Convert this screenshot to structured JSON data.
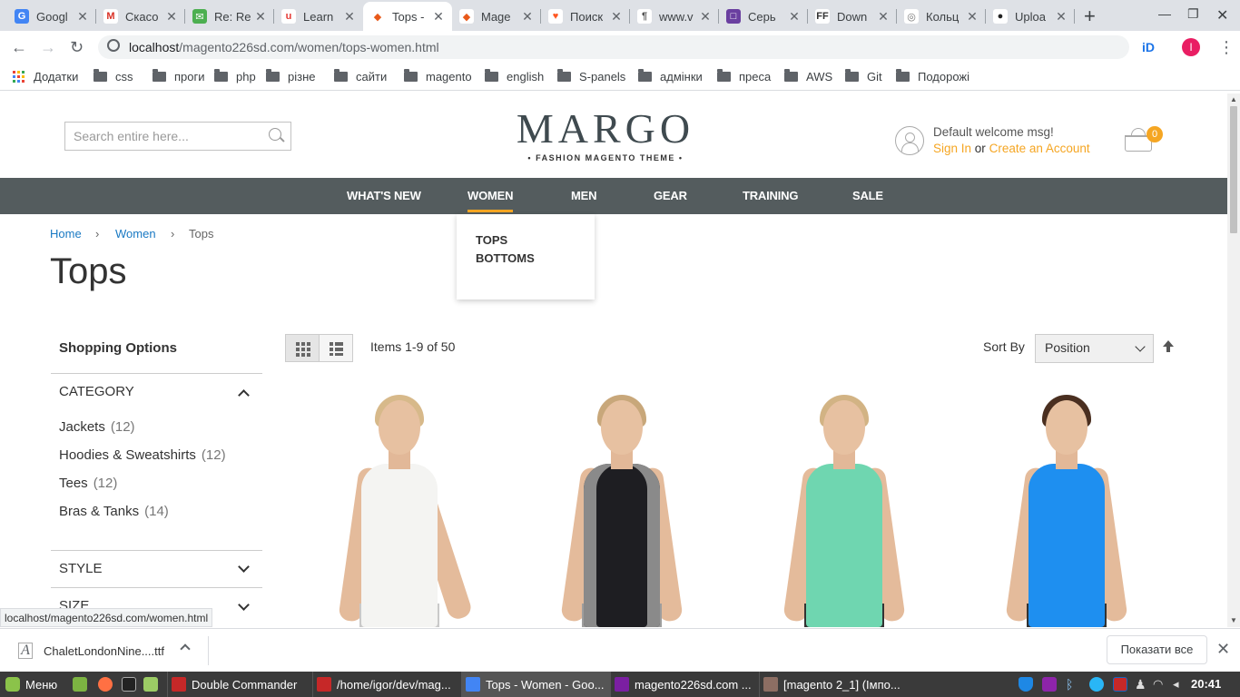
{
  "browser": {
    "tabs": [
      {
        "title": "Googl",
        "fav_bg": "#4285f4",
        "fav_txt": "G"
      },
      {
        "title": "Скасо",
        "fav_bg": "#ffffff",
        "fav_txt": "M",
        "fav_color": "#d93025"
      },
      {
        "title": "Re: Re",
        "fav_bg": "#4caf50",
        "fav_txt": "✉"
      },
      {
        "title": "Learn",
        "fav_bg": "#ffffff",
        "fav_txt": "u",
        "fav_color": "#e53935"
      },
      {
        "title": "Tops -",
        "fav_bg": "#ffffff",
        "fav_txt": "◆",
        "fav_color": "#e8591a",
        "active": true
      },
      {
        "title": "Mage",
        "fav_bg": "#ffffff",
        "fav_txt": "◆",
        "fav_color": "#e8591a"
      },
      {
        "title": "Поиск",
        "fav_bg": "#ffffff",
        "fav_txt": "♥",
        "fav_color": "#ff5722"
      },
      {
        "title": "www.v",
        "fav_bg": "#ffffff",
        "fav_txt": "¶",
        "fav_color": "#555555"
      },
      {
        "title": "Серь",
        "fav_bg": "#6a3fa0",
        "fav_txt": "□"
      },
      {
        "title": "Down",
        "fav_bg": "#ffffff",
        "fav_txt": "FF",
        "fav_color": "#333333"
      },
      {
        "title": "Кольц",
        "fav_bg": "#ffffff",
        "fav_txt": "◎",
        "fav_color": "#777777"
      },
      {
        "title": "Uploa",
        "fav_bg": "#ffffff",
        "fav_txt": "●",
        "fav_color": "#222222"
      }
    ],
    "url_host": "localhost",
    "url_path": "/magento226sd.com/women/tops-women.html",
    "profile_initial": "I",
    "bookmarks": [
      "Додатки",
      "css",
      "проги",
      "php",
      "різне",
      "сайти",
      "magento",
      "english",
      "S-panels",
      "адмінки",
      "преса",
      "AWS",
      "Git",
      "Подорожі"
    ]
  },
  "store": {
    "search_placeholder": "Search entire here...",
    "logo_main": "MARGO",
    "logo_sub": "• FASHION MAGENTO THEME •",
    "welcome": "Default welcome msg!",
    "sign_in": "Sign In",
    "or": "or",
    "create_account": "Create an Account",
    "cart_count": "0",
    "nav": [
      "WHAT'S NEW",
      "WOMEN",
      "MEN",
      "GEAR",
      "TRAINING",
      "SALE"
    ],
    "dropdown": [
      "TOPS",
      "BOTTOMS"
    ],
    "breadcrumb": {
      "home": "Home",
      "women": "Women",
      "current": "Tops"
    },
    "page_title": "Tops",
    "shopping_options": "Shopping Options",
    "filter_category": "CATEGORY",
    "categories": [
      {
        "name": "Jackets",
        "count": "(12)"
      },
      {
        "name": "Hoodies & Sweatshirts",
        "count": "(12)"
      },
      {
        "name": "Tees",
        "count": "(12)"
      },
      {
        "name": "Bras & Tanks",
        "count": "(14)"
      }
    ],
    "filter_style": "STYLE",
    "filter_size": "SIZE",
    "items_count": "Items 1-9 of 50",
    "sort_label": "Sort By",
    "sort_value": "Position",
    "product_colors": [
      "#f4f4f2",
      "#1e1e22",
      "#6fd6b0",
      "#1e8ff0"
    ],
    "accent": "#f5a623",
    "nav_bg": "#545c5e"
  },
  "status": {
    "hover_url": "localhost/magento226sd.com/women.html",
    "download_file": "ChaletLondonNine....ttf",
    "show_all": "Показати все"
  },
  "taskbar": {
    "menu": "Меню",
    "windows": [
      "Double Commander",
      "/home/igor/dev/mag...",
      "Tops - Women - Goo...",
      "magento226sd.com ...",
      "[magento 2_1] (Імпо..."
    ],
    "clock": "20:41"
  }
}
